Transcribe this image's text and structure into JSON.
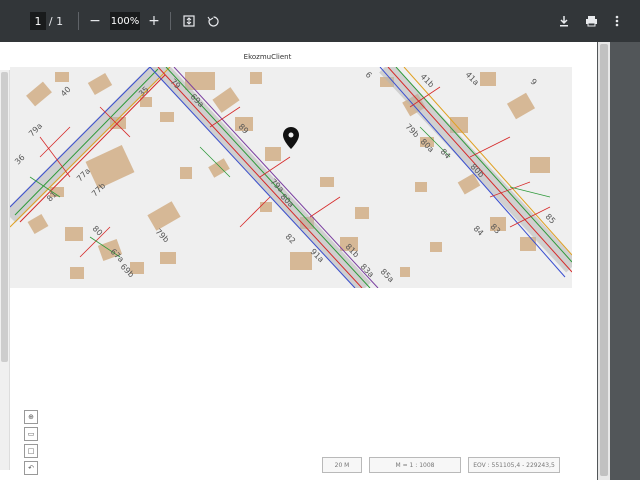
{
  "toolbar": {
    "page_current": "1",
    "page_sep": "/",
    "page_total": "1",
    "zoom_out": "−",
    "zoom_value": "100%",
    "zoom_in": "+",
    "icons": [
      "fit-page-icon",
      "rotate-icon",
      "download-icon",
      "print-icon",
      "more-icon"
    ]
  },
  "document": {
    "title": "EkozmuClient"
  },
  "map": {
    "labels": [
      "40",
      "35",
      "79a",
      "36",
      "81",
      "77a",
      "77b",
      "79b",
      "80",
      "67a",
      "69b",
      "79",
      "69a",
      "89",
      "79a",
      "80a",
      "82",
      "91a",
      "81b",
      "83a",
      "85a",
      "41b",
      "41a",
      "6",
      "9",
      "79b",
      "80a",
      "84",
      "80b",
      "83",
      "85",
      "84"
    ],
    "accent_colors": {
      "building": "#d6b896",
      "pipe_red": "#d62a2a",
      "pipe_green": "#2f9a3a",
      "pipe_blue": "#3a4fd0",
      "road": "#8a8a8a"
    }
  },
  "controls": {
    "zoom_full": "⊕",
    "select": "▭",
    "frame": "□",
    "undo": "↶"
  },
  "status": {
    "scale": "20 M",
    "ratio": "M = 1 : 1008",
    "coords": "EOV : 551105,4 - 229243,5"
  }
}
